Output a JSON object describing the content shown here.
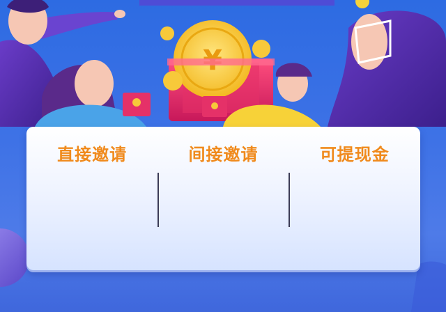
{
  "card": {
    "items": [
      {
        "label": "直接邀请"
      },
      {
        "label": "间接邀请"
      },
      {
        "label": "可提现金"
      }
    ]
  },
  "illustration": {
    "icon": "red-envelope-coin-icon",
    "coin_symbol": "¥",
    "colors": {
      "background": "#3e72e6",
      "envelope": "#e8336a",
      "coin": "#f8c838",
      "hair": "#5a2a8a",
      "label": "#f08a1c"
    }
  }
}
